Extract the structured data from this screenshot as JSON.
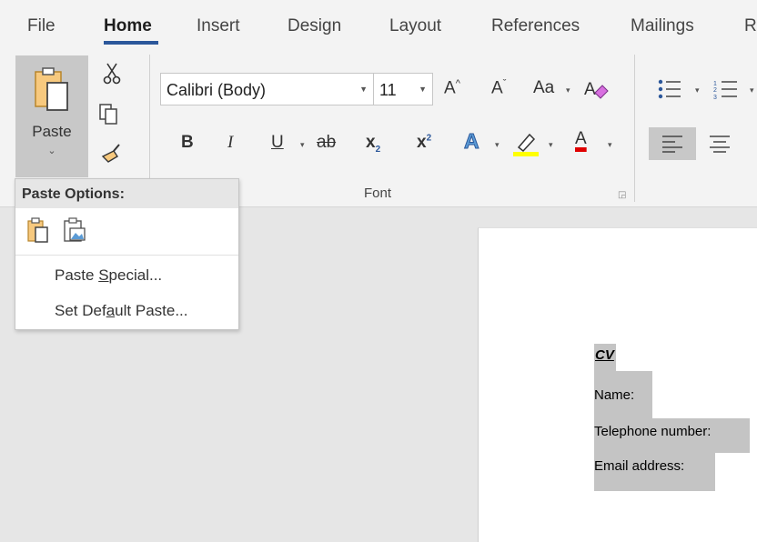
{
  "tabs": [
    {
      "label": "File"
    },
    {
      "label": "Home"
    },
    {
      "label": "Insert"
    },
    {
      "label": "Design"
    },
    {
      "label": "Layout"
    },
    {
      "label": "References"
    },
    {
      "label": "Mailings"
    },
    {
      "label": "R"
    }
  ],
  "clipboard": {
    "paste_label": "Paste",
    "paste_caret": "⌄"
  },
  "font": {
    "name": "Calibri (Body)",
    "size": "11",
    "group_label": "Font",
    "grow": "A",
    "shrink": "A",
    "change_case": "Aa",
    "bold": "B",
    "italic": "I",
    "underline": "U",
    "strike": "ab",
    "subscript": "x",
    "sub_mark": "2",
    "superscript": "x",
    "sup_mark": "2",
    "text_effects": "A",
    "font_color": "A",
    "highlight_color": "#ffff00",
    "font_color_bar": "#e00000"
  },
  "paste_options": {
    "header": "Paste Options:",
    "paste_special_pre": "Paste ",
    "paste_special_u": "S",
    "paste_special_post": "pecial...",
    "set_default_pre": "Set Def",
    "set_default_u": "a",
    "set_default_post": "ult Paste..."
  },
  "document": {
    "lines": [
      {
        "text": "CV"
      },
      {
        "text": "Name:"
      },
      {
        "text": "Telephone number:"
      },
      {
        "text": "Email address:"
      }
    ]
  },
  "colors": {
    "accent": "#2b579a"
  }
}
